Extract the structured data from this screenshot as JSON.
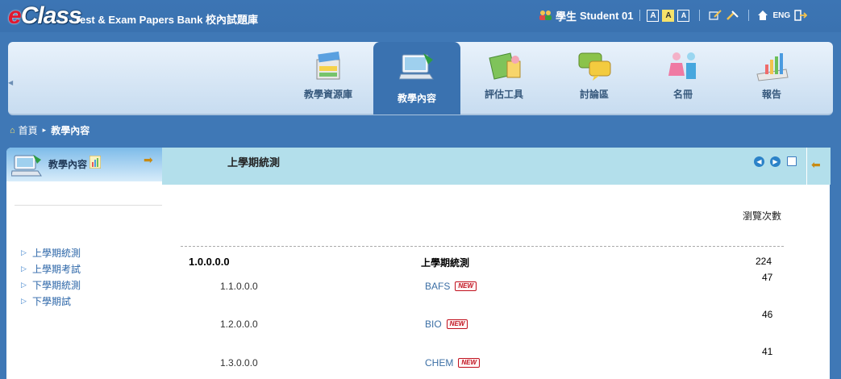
{
  "app": {
    "logo": "eClass",
    "system_title": "Test & Exam Papers Bank 校內試題庫"
  },
  "user": {
    "role": "學生",
    "name": "Student 01",
    "font_sizes": [
      "A",
      "A",
      "A"
    ],
    "lang": "ENG"
  },
  "nav": {
    "tabs": [
      {
        "label": "教學資源庫",
        "icon": "resource-bank-icon"
      },
      {
        "label": "教學內容",
        "icon": "teaching-content-icon",
        "active": true
      },
      {
        "label": "評估工具",
        "icon": "assessment-tools-icon"
      },
      {
        "label": "討論區",
        "icon": "forum-icon"
      },
      {
        "label": "名冊",
        "icon": "roster-icon"
      },
      {
        "label": "報告",
        "icon": "report-icon"
      }
    ]
  },
  "breadcrumb": {
    "home": "首頁",
    "current": "教學內容"
  },
  "left_panel": {
    "title": "教學內容",
    "items": [
      "上學期統測",
      "上學期考試",
      "下學期統測",
      "下學期試"
    ]
  },
  "main": {
    "title": "上學期統測",
    "view_count_header": "瀏覽次數",
    "top_row": {
      "code": "1.0.0.0.0",
      "name": "上學期統測",
      "count": "224"
    },
    "rows": [
      {
        "code": "1.1.0.0.0",
        "name": "BAFS",
        "badge": "NEW",
        "count": "47"
      },
      {
        "code": "1.2.0.0.0",
        "name": "BIO",
        "badge": "NEW",
        "count": "46"
      },
      {
        "code": "1.3.0.0.0",
        "name": "CHEM",
        "badge": "NEW",
        "count": "41"
      }
    ]
  },
  "colors": {
    "background": "#3f78b6",
    "main_header": "#b3dfeb",
    "link": "#3c6fa5",
    "new_badge": "#c1121f"
  }
}
